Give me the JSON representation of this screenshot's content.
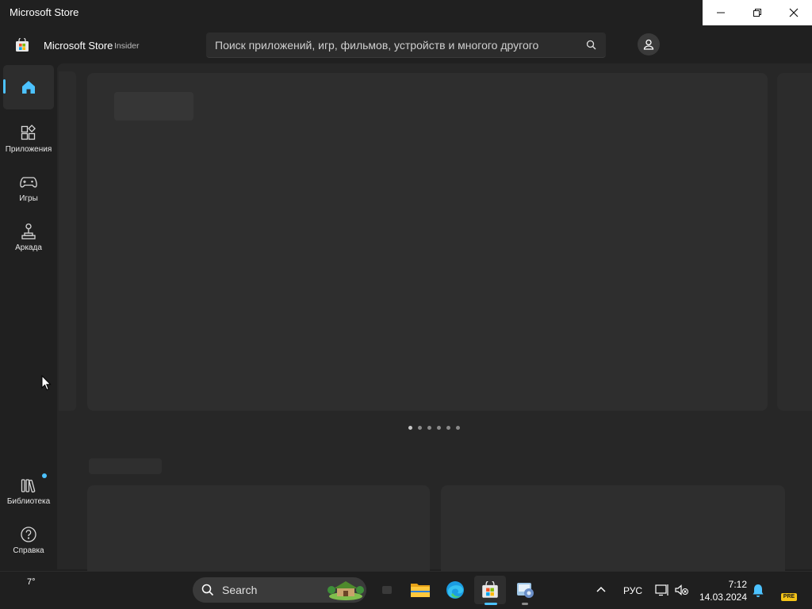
{
  "window": {
    "title": "Microsoft Store",
    "controls": [
      "minimize",
      "restore",
      "close"
    ]
  },
  "header": {
    "app_name": "Microsoft Store",
    "badge": "Insider",
    "search_placeholder": "Поиск приложений, игр, фильмов, устройств и многого другого",
    "search_icon": "search-icon",
    "account_icon": "account-icon"
  },
  "nav": {
    "items": [
      {
        "label": "",
        "icon": "home-icon",
        "active": true
      },
      {
        "label": "Приложения",
        "icon": "apps-icon"
      },
      {
        "label": "Игры",
        "icon": "gamepad-icon"
      },
      {
        "label": "Аркада",
        "icon": "joystick-icon"
      }
    ],
    "bottom": [
      {
        "label": "Библиотека",
        "icon": "library-icon",
        "has_update_dot": true
      },
      {
        "label": "Справка",
        "icon": "help-icon"
      }
    ]
  },
  "content": {
    "loading": true,
    "carousel": {
      "page_count": 6,
      "current_index": 0
    }
  },
  "taskbar": {
    "weather": "7°",
    "search_label": "Search",
    "pinned": [
      "task-view-icon",
      "file-explorer-icon",
      "edge-icon",
      "store-icon",
      "control-panel-icon"
    ],
    "language": "РУС",
    "time": "7:12",
    "date": "14.03.2024",
    "pre_badge": "PRE"
  },
  "colors": {
    "accent": "#4cc2ff",
    "background": "#202020",
    "content": "#272727"
  }
}
